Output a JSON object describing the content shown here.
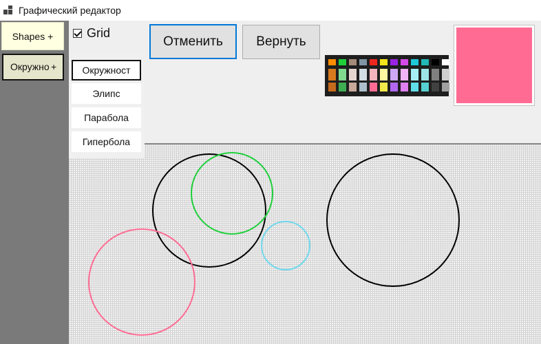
{
  "window": {
    "title": "Графический редактор"
  },
  "sidebar": {
    "shapes_label": "Shapes",
    "shapes_plus": "+",
    "circle_label": "Окружно",
    "circle_plus": "+"
  },
  "toolbar": {
    "grid_label": "Grid",
    "grid_checked": true,
    "cancel_label": "Отменить",
    "redo_label": "Вернуть"
  },
  "dropdown": {
    "items": [
      "Окружност",
      "Элипс",
      "Парабола",
      "Гипербола"
    ],
    "selected_index": 0
  },
  "palette": {
    "columns": [
      [
        "#ff8c00",
        "#d77a1e",
        "#c46a1c"
      ],
      [
        "#1ecf3a",
        "#7fd98f",
        "#3fae52"
      ],
      [
        "#a58a7a",
        "#e7d6d0",
        "#c8a99a"
      ],
      [
        "#7f95a6",
        "#d3dde4",
        "#aebfcb"
      ],
      [
        "#f0261e",
        "#f4b5bd",
        "#ff6b93"
      ],
      [
        "#f6e51a",
        "#fff6a0",
        "#f2e94a"
      ],
      [
        "#9a22e0",
        "#cda8f5",
        "#b167f0"
      ],
      [
        "#d44ae8",
        "#f1b5f7",
        "#e07ff0"
      ],
      [
        "#1ec8d8",
        "#a6eef5",
        "#5fdde9"
      ],
      [
        "#22b8b8",
        "#9ee6e6",
        "#56d0d0"
      ],
      [
        "#000000",
        "#808080",
        "#404040"
      ],
      [
        "#ffffff",
        "#d0d0d0",
        "#a0a0a0"
      ]
    ]
  },
  "current_color": "#ff6b93"
}
